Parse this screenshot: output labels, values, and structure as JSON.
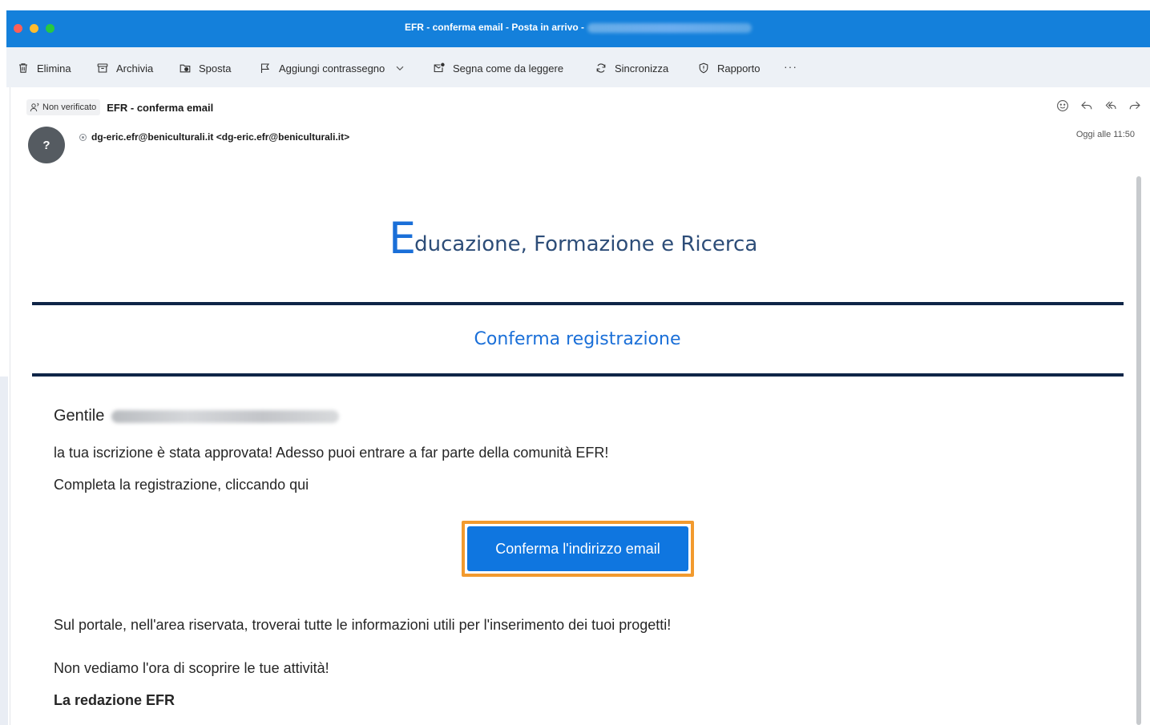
{
  "window": {
    "title": "EFR - conferma email - Posta in arrivo -"
  },
  "toolbar": {
    "delete_label": "Elimina",
    "archive_label": "Archivia",
    "move_label": "Sposta",
    "flag_label": "Aggiungi contrassegno",
    "mark_unread_label": "Segna come da leggere",
    "sync_label": "Sincronizza",
    "report_label": "Rapporto",
    "more_label": "···"
  },
  "message": {
    "unverified_label": "Non verificato",
    "subject": "EFR - conferma email",
    "avatar_initial": "?",
    "sender": "dg-eric.efr@beniculturali.it <dg-eric.efr@beniculturali.it>",
    "received": "Oggi alle 11:50"
  },
  "email": {
    "logo_initial": "E",
    "logo_rest": "ducazione, Formazione e Ricerca",
    "heading": "Conferma registrazione",
    "greeting": "Gentile",
    "approved_text": "la tua iscrizione è stata approvata! Adesso puoi entrare a far parte della comunità EFR!",
    "complete_text": "Completa la registrazione, cliccando qui",
    "cta_label": "Conferma l'indirizzo email",
    "portal_text": "Sul portale, nell'area riservata, troverai tutte le informazioni utili per l'inserimento dei tuoi progetti!",
    "closing_text": "Non vediamo l'ora di scoprire le tue attività!",
    "signature": "La redazione EFR"
  },
  "colors": {
    "titlebar": "#1480db",
    "accent": "#1a6fd8",
    "rule": "#0f2547",
    "cta": "#0f76e0",
    "highlight": "#f29a2e"
  }
}
